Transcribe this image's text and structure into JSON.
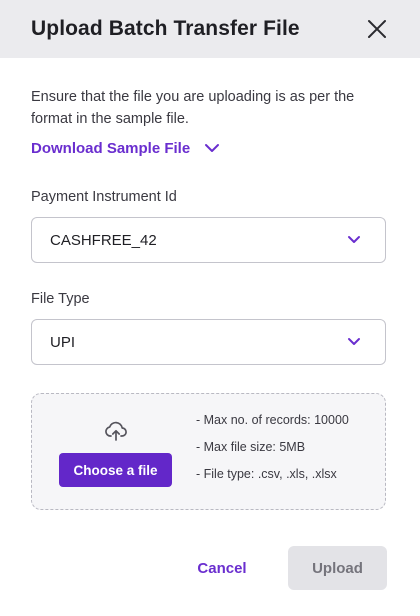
{
  "dialog": {
    "title": "Upload Batch Transfer File",
    "description": "Ensure that the file you are uploading is as per the format in the sample file.",
    "download_link": "Download Sample File"
  },
  "fields": {
    "payment_instrument": {
      "label": "Payment Instrument Id",
      "value": "CASHFREE_42"
    },
    "file_type": {
      "label": "File Type",
      "value": "UPI"
    }
  },
  "dropzone": {
    "icon": "cloud-upload-icon",
    "choose_label": "Choose a file",
    "rules": [
      "- Max no. of records: 10000",
      "- Max file size: 5MB",
      "- File type: .csv, .xls, .xlsx"
    ]
  },
  "footer": {
    "cancel_label": "Cancel",
    "upload_label": "Upload"
  },
  "colors": {
    "accent": "#6327c9",
    "link": "#6a2ecf",
    "header_bg": "#ebebee"
  }
}
